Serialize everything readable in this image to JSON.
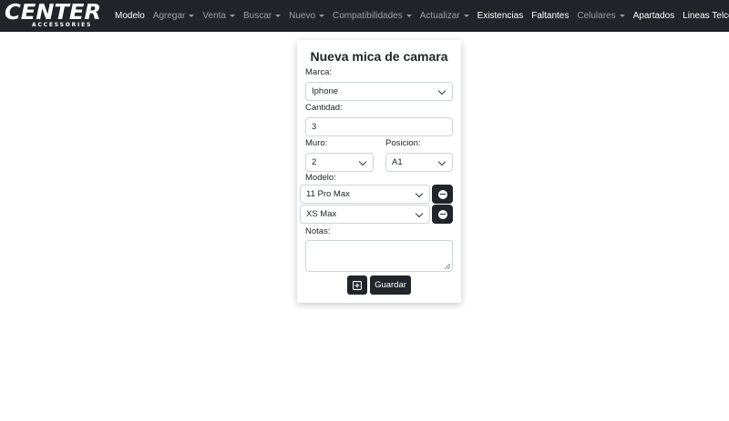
{
  "navbar": {
    "logo_main": "CENTER",
    "logo_sub": "ACCESSORIES",
    "items": [
      {
        "label": "Modelo",
        "dropdown": false,
        "active": true
      },
      {
        "label": "Agregar",
        "dropdown": true,
        "active": false
      },
      {
        "label": "Venta",
        "dropdown": true,
        "active": false
      },
      {
        "label": "Buscar",
        "dropdown": true,
        "active": false
      },
      {
        "label": "Nuevo",
        "dropdown": true,
        "active": false
      },
      {
        "label": "Compatibilidades",
        "dropdown": true,
        "active": false
      },
      {
        "label": "Actualizar",
        "dropdown": true,
        "active": false
      },
      {
        "label": "Existencias",
        "dropdown": false,
        "active": true
      },
      {
        "label": "Faltantes",
        "dropdown": false,
        "active": true
      },
      {
        "label": "Celulares",
        "dropdown": true,
        "active": false
      },
      {
        "label": "Apartados",
        "dropdown": false,
        "active": true
      },
      {
        "label": "Lineas Telcel",
        "dropdown": false,
        "active": true
      }
    ]
  },
  "form": {
    "title": "Nueva mica de camara",
    "marca_label": "Marca:",
    "marca_value": "Iphone",
    "cantidad_label": "Cantidad:",
    "cantidad_value": "3",
    "muro_label": "Muro:",
    "muro_value": "2",
    "posicion_label": "Posicion:",
    "posicion_value": "A1",
    "modelo_label": "Modelo:",
    "modelos": [
      "11 Pro Max",
      "XS Max"
    ],
    "notas_label": "Notas:",
    "notas_value": "",
    "add_icon": "plus-square-icon",
    "save_label": "Guardar"
  },
  "colors": {
    "navbar_bg": "#212529",
    "button_dark": "#212529",
    "border": "#ced4da"
  }
}
